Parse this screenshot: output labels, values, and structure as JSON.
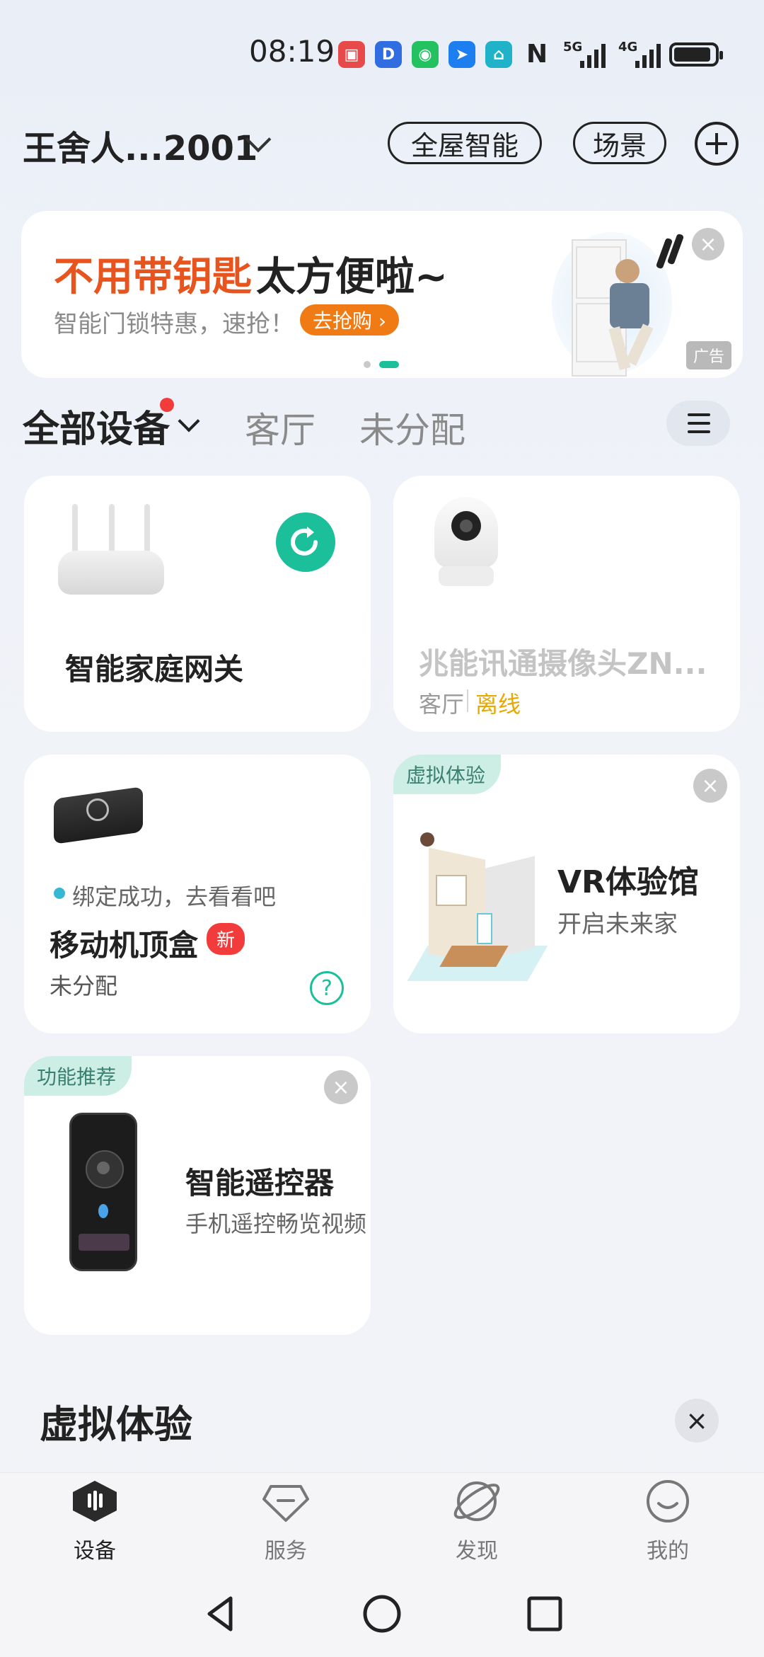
{
  "status_bar": {
    "time": "08:19",
    "network_5g": "5G",
    "network_4g": "4G",
    "app_icons": [
      "red-app-icon",
      "d-app-icon",
      "wechat-icon",
      "arrow-app-icon",
      "home-app-icon"
    ]
  },
  "header": {
    "home_name": "王舍人...2001",
    "whole_house_label": "全屋智能",
    "scene_label": "场景"
  },
  "banner": {
    "title_highlight": "不用带钥匙",
    "title_rest": "太方便啦~",
    "subtitle": "智能门锁特惠，速抢！",
    "cta_label": "去抢购 ›",
    "ad_label": "广告"
  },
  "tabs": {
    "all_devices": "全部设备",
    "living_room": "客厅",
    "unassigned": "未分配"
  },
  "cards": {
    "gateway": {
      "title": "智能家庭网关"
    },
    "camera": {
      "title": "兆能讯通摄像头ZN...",
      "room": "客厅",
      "status": "离线"
    },
    "settop": {
      "bind_msg": "绑定成功，去看看吧",
      "title": "移动机顶盒",
      "new_badge": "新",
      "room": "未分配",
      "help": "?"
    },
    "vr": {
      "badge": "虚拟体验",
      "title": "VR体验馆",
      "subtitle": "开启未来家"
    },
    "remote": {
      "badge": "功能推荐",
      "title": "智能遥控器",
      "subtitle": "手机遥控畅览视频"
    }
  },
  "section": {
    "title": "虚拟体验"
  },
  "bottom_nav": [
    {
      "label": "设备",
      "active": true
    },
    {
      "label": "服务",
      "active": false
    },
    {
      "label": "发现",
      "active": false
    },
    {
      "label": "我的",
      "active": false
    }
  ],
  "colors": {
    "accent": "#1bbf9a",
    "offline": "#e8a800",
    "promo": "#e8541e"
  }
}
